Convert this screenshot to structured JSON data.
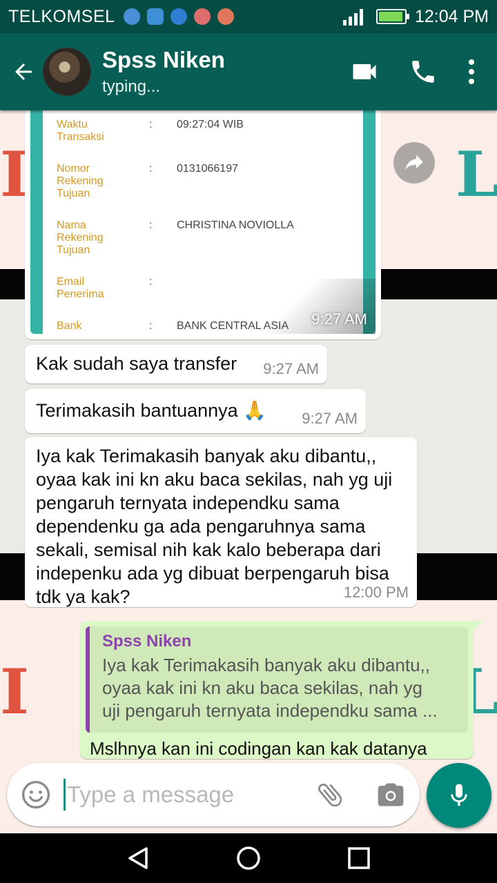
{
  "status_bar": {
    "carrier": "TELKOMSEL",
    "time": "12:04 PM",
    "notification_colors": [
      "#4a90d9",
      "#3d8fd6",
      "#2f7dd0",
      "#e06d6d",
      "#e0775a"
    ]
  },
  "header": {
    "contact_name": "Spss Niken",
    "status": "typing..."
  },
  "receipt": {
    "rows": [
      {
        "label": "Waktu Transaksi",
        "value": "09:27:04 WIB"
      },
      {
        "label": "Nomor Rekening Tujuan",
        "value": "0131066197"
      },
      {
        "label": "Nama Rekening Tujuan",
        "value": "CHRISTINA NOVIOLLA"
      },
      {
        "label": "Email Penerima",
        "value": ""
      },
      {
        "label": "Bank",
        "value": "BANK CENTRAL ASIA"
      }
    ],
    "time": "9:27 AM"
  },
  "messages": [
    {
      "text": "Kak sudah saya transfer",
      "time": "9:27 AM"
    },
    {
      "text": "Terimakasih bantuannya 🙏",
      "time": "9:27 AM"
    },
    {
      "text": "Iya kak Terimakasih banyak aku dibantu,, oyaa kak ini kn aku baca sekilas, nah yg uji pengaruh ternyata independku sama dependenku ga ada pengaruhnya sama sekali, semisal nih kak kalo beberapa dari indepenku ada yg dibuat berpengaruh bisa tdk ya kak?",
      "time": "12:00 PM"
    }
  ],
  "reply": {
    "quoted_name": "Spss Niken",
    "quoted_line_1": "Iya kak Terimakasih banyak aku dibantu,,",
    "quoted_line_2": "oyaa kak ini kn aku baca sekilas, nah yg",
    "quoted_line_3": "uji pengaruh ternyata independku sama ...",
    "text": "Mslhnya kan ini codingan kan kak datanya"
  },
  "composer": {
    "placeholder": "Type a message"
  },
  "colors": {
    "header": "#075e54",
    "status_bar": "#054d44",
    "outgoing_bubble": "#dcf8c6",
    "accent": "#00897b",
    "quote_name": "#8e44ad"
  },
  "icons": [
    "back-arrow-icon",
    "video-call-icon",
    "phone-icon",
    "more-options-icon",
    "forward-icon",
    "emoji-icon",
    "attach-icon",
    "camera-icon",
    "mic-icon",
    "nav-back-icon",
    "nav-home-icon",
    "nav-recents-icon"
  ]
}
